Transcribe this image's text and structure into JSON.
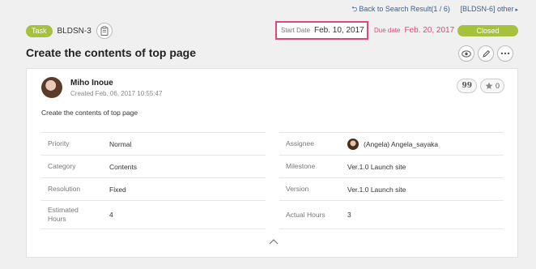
{
  "topnav": {
    "back_label": "Back to Search Result(1 / 6)",
    "other_label": "[BLDSN-6] other",
    "arrow": "▸"
  },
  "task": {
    "type_badge": "Task",
    "key": "BLDSN-3"
  },
  "dates": {
    "start_label": "Start Date",
    "start_value": "Feb. 10, 2017",
    "due_label": "Due date",
    "due_value": "Feb. 20, 2017"
  },
  "status": "Closed",
  "title": "Create the contents of top page",
  "comment": {
    "author": "Miho Inoue",
    "created": "Created  Feb. 06, 2017 10:55:47",
    "quote_glyph": "99",
    "star_count": "0",
    "description": "Create the contents of top page"
  },
  "properties": {
    "left": [
      {
        "key": "Priority",
        "value": "Normal"
      },
      {
        "key": "Category",
        "value": "Contents"
      },
      {
        "key": "Resolution",
        "value": "Fixed"
      },
      {
        "key": "Estimated Hours",
        "value": "4"
      }
    ],
    "right": [
      {
        "key": "Assignee",
        "value": "(Angela) Angela_sayaka"
      },
      {
        "key": "Milestone",
        "value": "Ver.1.0 Launch site"
      },
      {
        "key": "Version",
        "value": "Ver.1.0 Launch site"
      },
      {
        "key": "Actual Hours",
        "value": "3"
      }
    ]
  },
  "icons": {
    "back": "back-arrow-icon",
    "copy": "clipboard-icon",
    "watch": "eye-icon",
    "edit": "pencil-icon",
    "more": "more-icon",
    "quote": "quote-icon",
    "star": "star-icon",
    "collapse": "chevron-up-icon"
  },
  "colors": {
    "accent_green": "#a6c13d",
    "highlight_pink": "#e0467a",
    "link_blue": "#3b5e8c"
  }
}
